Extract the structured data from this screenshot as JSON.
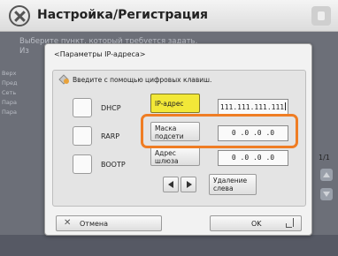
{
  "title": "Настройка/Регистрация",
  "background": {
    "instruction_line1": "Выберите пункт, который требуется задать.",
    "instruction_line2": "Из",
    "list_items": [
      "Верх",
      "Пред",
      "Сеть",
      "Пара",
      "Пара"
    ],
    "page_indicator": "1/1"
  },
  "dialog": {
    "title": "<Параметры IP-адреса>",
    "hint": "Введите с помощью цифровых клавиш.",
    "checkboxes": [
      {
        "label": "DHCP",
        "checked": false
      },
      {
        "label": "RARP",
        "checked": false
      },
      {
        "label": "BOOTP",
        "checked": false
      }
    ],
    "fields": [
      {
        "label": "IP-адрес",
        "value": "111.111.111.111",
        "active": true
      },
      {
        "label": "Маска подсети",
        "value": "0 .0 .0 .0",
        "active": false
      },
      {
        "label": "Адрес шлюза",
        "value": "0 .0 .0 .0",
        "active": false
      }
    ],
    "delete_label": "Удаление слева",
    "cancel_label": "Отмена",
    "ok_label": "OK"
  },
  "colors": {
    "highlight": "#ef7d24",
    "active_field": "#f2e838"
  }
}
